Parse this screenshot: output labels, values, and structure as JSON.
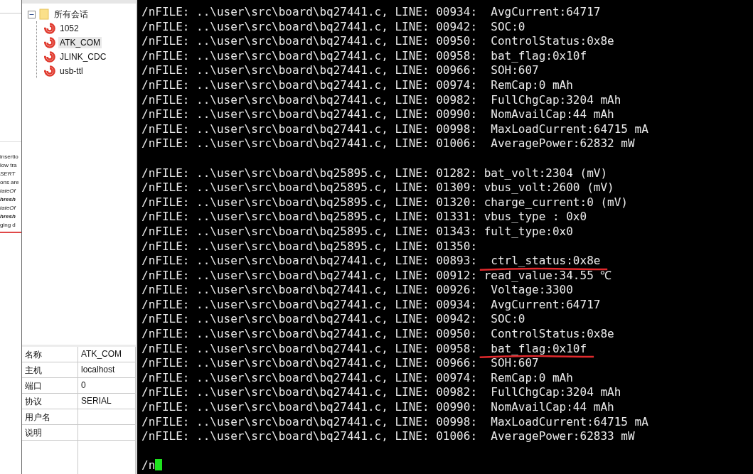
{
  "background_window": {
    "texts": [
      {
        "text": "insertio",
        "kind": "normal"
      },
      {
        "text": "low tra",
        "kind": "normal"
      },
      {
        "text": "SERT",
        "kind": "italic"
      },
      {
        "text": "ons are",
        "kind": "normal"
      },
      {
        "text": "tateOf",
        "kind": "italic"
      },
      {
        "text": "hresh",
        "kind": "emphasis"
      },
      {
        "text": "tateOf",
        "kind": "italic"
      },
      {
        "text": "hresh",
        "kind": "emphasis"
      },
      {
        "text": "ging d",
        "kind": "normal"
      }
    ]
  },
  "session_tree": {
    "label": "所有会话",
    "expanded": true,
    "children": [
      {
        "label": "1052",
        "selected": false
      },
      {
        "label": "ATK_COM",
        "selected": true
      },
      {
        "label": "JLINK_CDC",
        "selected": false
      },
      {
        "label": "usb-ttl",
        "selected": false
      }
    ]
  },
  "properties": [
    {
      "name": "名称",
      "value": "ATK_COM"
    },
    {
      "name": "主机",
      "value": "localhost"
    },
    {
      "name": "端口",
      "value": "0"
    },
    {
      "name": "协议",
      "value": "SERIAL"
    },
    {
      "name": "用户名"
    },
    {
      "name": "说明"
    }
  ],
  "terminal": {
    "lines": [
      {
        "kind": "log",
        "source": "/nFILE: ..\\user\\src\\board\\bq27441.c, LINE: 00934:",
        "message": "  AvgCurrent:64717",
        "underlined": false
      },
      {
        "kind": "log",
        "source": "/nFILE: ..\\user\\src\\board\\bq27441.c, LINE: 00942:",
        "message": "  SOC:0",
        "underlined": false
      },
      {
        "kind": "log",
        "source": "/nFILE: ..\\user\\src\\board\\bq27441.c, LINE: 00950:",
        "message": "  ControlStatus:0x8e",
        "underlined": false
      },
      {
        "kind": "log",
        "source": "/nFILE: ..\\user\\src\\board\\bq27441.c, LINE: 00958:",
        "message": "  bat_flag:0x10f",
        "underlined": false
      },
      {
        "kind": "log",
        "source": "/nFILE: ..\\user\\src\\board\\bq27441.c, LINE: 00966:",
        "message": "  SOH:607",
        "underlined": false
      },
      {
        "kind": "log",
        "source": "/nFILE: ..\\user\\src\\board\\bq27441.c, LINE: 00974:",
        "message": "  RemCap:0 mAh",
        "underlined": false
      },
      {
        "kind": "log",
        "source": "/nFILE: ..\\user\\src\\board\\bq27441.c, LINE: 00982:",
        "message": "  FullChgCap:3204 mAh",
        "underlined": false
      },
      {
        "kind": "log",
        "source": "/nFILE: ..\\user\\src\\board\\bq27441.c, LINE: 00990:",
        "message": "  NomAvailCap:44 mAh",
        "underlined": false
      },
      {
        "kind": "log",
        "source": "/nFILE: ..\\user\\src\\board\\bq27441.c, LINE: 00998:",
        "message": "  MaxLoadCurrent:64715 mA",
        "underlined": false
      },
      {
        "kind": "log",
        "source": "/nFILE: ..\\user\\src\\board\\bq27441.c, LINE: 01006:",
        "message": "  AveragePower:62832 mW",
        "underlined": false
      },
      {
        "kind": "blank"
      },
      {
        "kind": "log",
        "source": "/nFILE: ..\\user\\src\\board\\bq25895.c, LINE: 01282:",
        "message": " bat_volt:2304 (mV)",
        "underlined": false
      },
      {
        "kind": "log",
        "source": "/nFILE: ..\\user\\src\\board\\bq25895.c, LINE: 01309:",
        "message": " vbus_volt:2600 (mV)",
        "underlined": false
      },
      {
        "kind": "log",
        "source": "/nFILE: ..\\user\\src\\board\\bq25895.c, LINE: 01320:",
        "message": " charge_current:0 (mV)",
        "underlined": false
      },
      {
        "kind": "log",
        "source": "/nFILE: ..\\user\\src\\board\\bq25895.c, LINE: 01331:",
        "message": " vbus_type : 0x0",
        "underlined": false
      },
      {
        "kind": "log",
        "source": "/nFILE: ..\\user\\src\\board\\bq25895.c, LINE: 01343:",
        "message": " fult_type:0x0",
        "underlined": false
      },
      {
        "kind": "log",
        "source": "/nFILE: ..\\user\\src\\board\\bq25895.c, LINE: 01350:",
        "underlined": false
      },
      {
        "kind": "log",
        "source": "/nFILE: ..\\user\\src\\board\\bq27441.c, LINE: 00893:",
        "message": "  ctrl_status:0x8e",
        "underlined": true
      },
      {
        "kind": "log",
        "source": "/nFILE: ..\\user\\src\\board\\bq27441.c, LINE: 00912:",
        "message": " read_value:34.55 ℃",
        "underlined": false
      },
      {
        "kind": "log",
        "source": "/nFILE: ..\\user\\src\\board\\bq27441.c, LINE: 00926:",
        "message": "  Voltage:3300",
        "underlined": false
      },
      {
        "kind": "log",
        "source": "/nFILE: ..\\user\\src\\board\\bq27441.c, LINE: 00934:",
        "message": "  AvgCurrent:64717",
        "underlined": false
      },
      {
        "kind": "log",
        "source": "/nFILE: ..\\user\\src\\board\\bq27441.c, LINE: 00942:",
        "message": "  SOC:0",
        "underlined": false
      },
      {
        "kind": "log",
        "source": "/nFILE: ..\\user\\src\\board\\bq27441.c, LINE: 00950:",
        "message": "  ControlStatus:0x8e",
        "underlined": false
      },
      {
        "kind": "log",
        "source": "/nFILE: ..\\user\\src\\board\\bq27441.c, LINE: 00958:",
        "message": "  bat_flag:0x10f",
        "underlined": true
      },
      {
        "kind": "log",
        "source": "/nFILE: ..\\user\\src\\board\\bq27441.c, LINE: 00966:",
        "message": "  SOH:607",
        "underlined": false
      },
      {
        "kind": "log",
        "source": "/nFILE: ..\\user\\src\\board\\bq27441.c, LINE: 00974:",
        "message": "  RemCap:0 mAh",
        "underlined": false
      },
      {
        "kind": "log",
        "source": "/nFILE: ..\\user\\src\\board\\bq27441.c, LINE: 00982:",
        "message": "  FullChgCap:3204 mAh",
        "underlined": false
      },
      {
        "kind": "log",
        "source": "/nFILE: ..\\user\\src\\board\\bq27441.c, LINE: 00990:",
        "message": "  NomAvailCap:44 mAh",
        "underlined": false
      },
      {
        "kind": "log",
        "source": "/nFILE: ..\\user\\src\\board\\bq27441.c, LINE: 00998:",
        "message": "  MaxLoadCurrent:64715 mA",
        "underlined": false
      },
      {
        "kind": "log",
        "source": "/nFILE: ..\\user\\src\\board\\bq27441.c, LINE: 01006:",
        "message": "  AveragePower:62833 mW",
        "underlined": false
      },
      {
        "kind": "blank"
      }
    ],
    "prompt": "/n"
  }
}
